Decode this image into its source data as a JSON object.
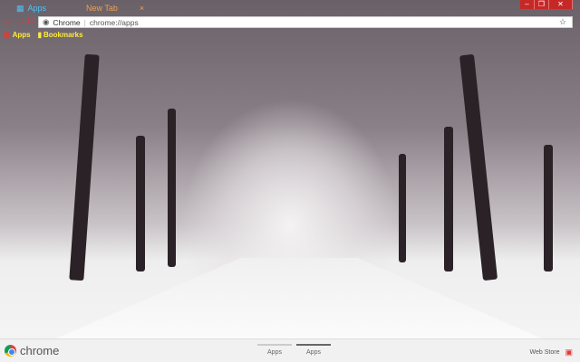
{
  "tabs": [
    {
      "label": "Apps",
      "active": true
    },
    {
      "label": "New Tab",
      "active": false
    }
  ],
  "omnibox": {
    "site_label": "Chrome",
    "url": "chrome://apps"
  },
  "bookmarks": [
    {
      "label": "Apps",
      "icon": "apps-grid-icon"
    },
    {
      "label": "Bookmarks",
      "icon": "folder-icon"
    }
  ],
  "footer": {
    "logo_text": "chrome",
    "pages": [
      {
        "label": "Apps",
        "active": false
      },
      {
        "label": "Apps",
        "active": true
      }
    ],
    "web_store": "Web Store"
  },
  "colors": {
    "accent": "#c62828",
    "bookmark_text": "#ffeb3b"
  }
}
